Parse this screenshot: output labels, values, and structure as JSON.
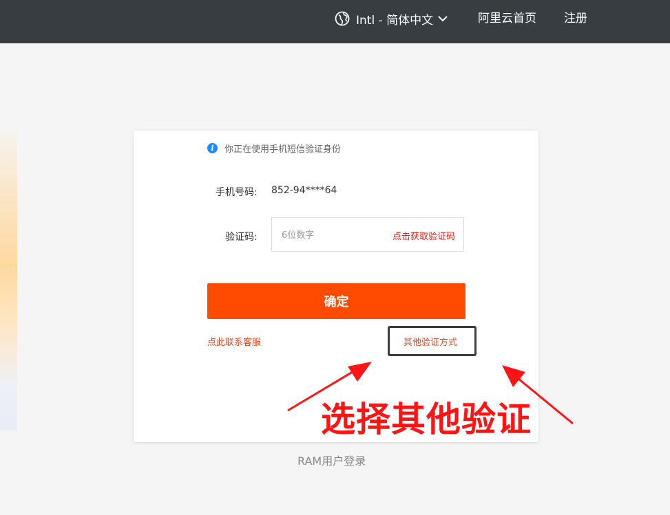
{
  "header": {
    "language_label": "Intl - 简体中文",
    "home_link": "阿里云首页",
    "register_link": "注册",
    "globe_icon": "globe-icon",
    "chevron_icon": "chevron-down-icon"
  },
  "card": {
    "info_text": "你正在使用手机短信验证身份",
    "info_icon": "info-icon",
    "phone_label": "手机号码:",
    "phone_value": "852-94****64",
    "code_label": "验证码:",
    "code_placeholder": "6位数字",
    "code_value": "",
    "get_code_link": "点击获取验证码",
    "confirm_button": "确定",
    "contact_link": "点此联系客服",
    "other_method_link": "其他验证方式"
  },
  "footer": {
    "ram_login_link": "RAM用户登录"
  },
  "annotation": {
    "text": "选择其他验证"
  },
  "colors": {
    "header_bg": "#373d41",
    "accent": "#ff4a00",
    "link_red": "#e0481b",
    "annotation_red": "#ff1414",
    "info_blue": "#1a8cff"
  }
}
